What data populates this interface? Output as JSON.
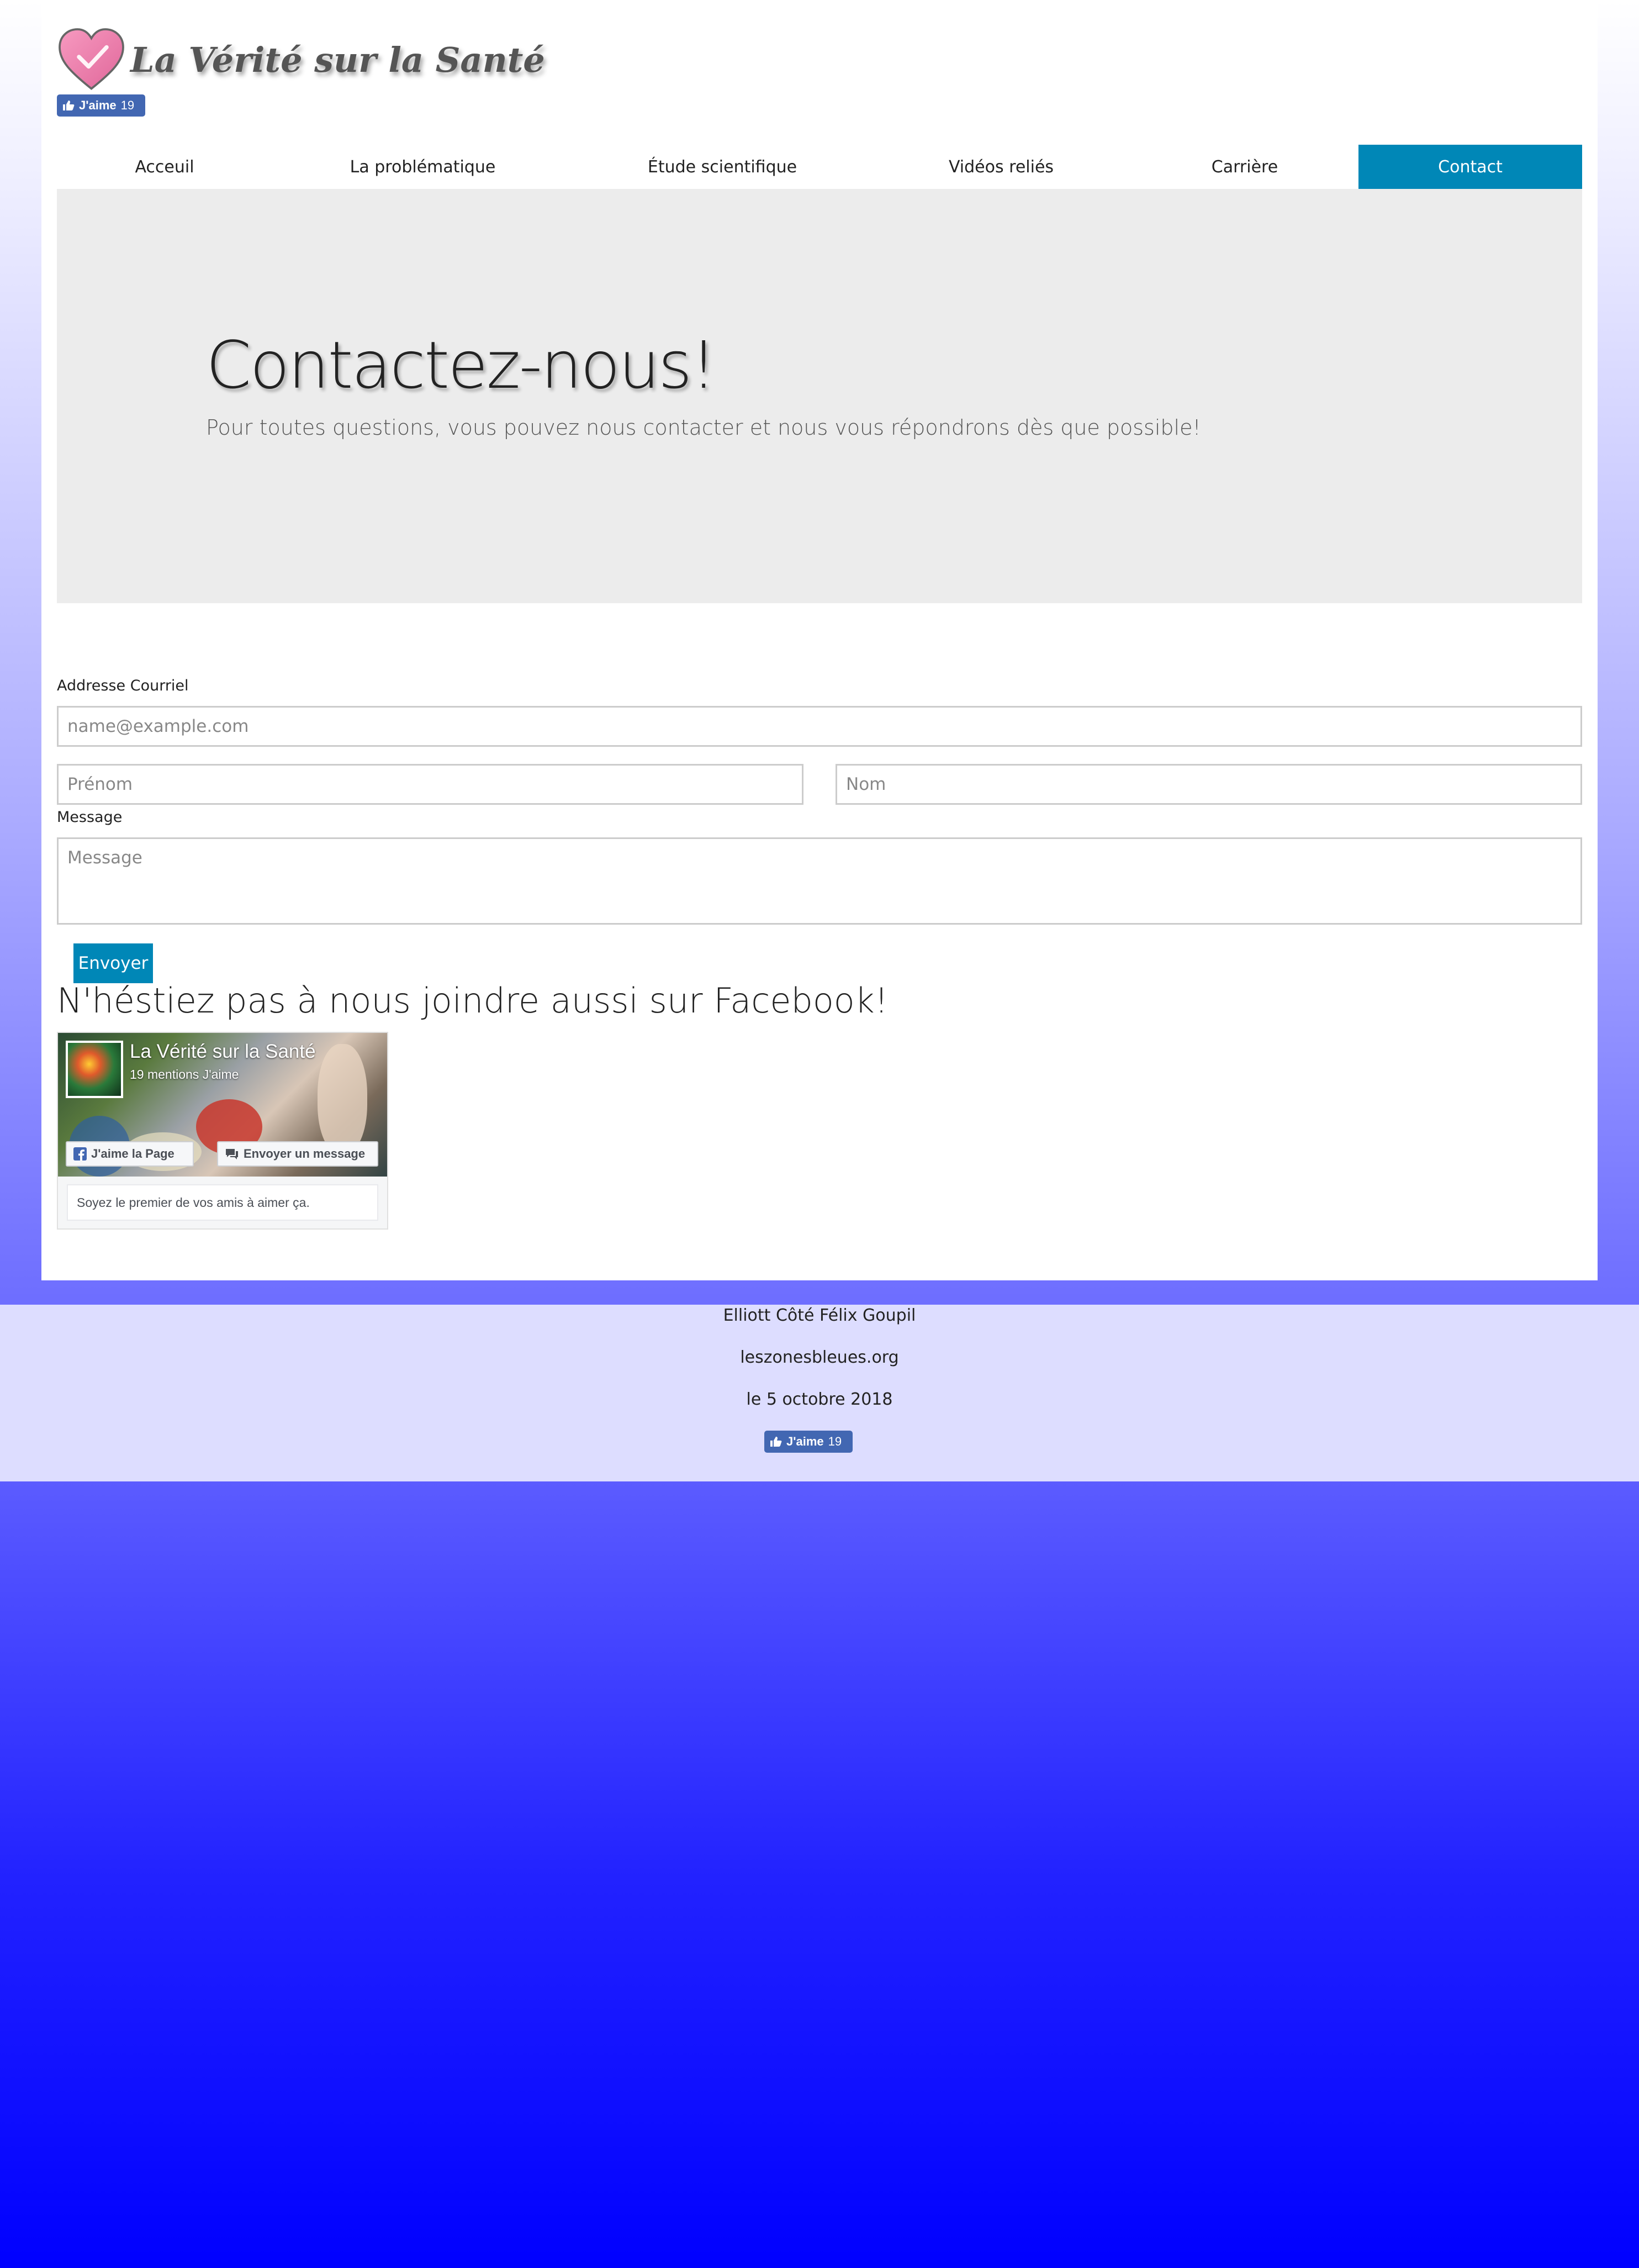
{
  "brand": {
    "name": "La Vérité sur la Santé"
  },
  "fb_like_button": {
    "label": "J'aime",
    "count": "19"
  },
  "nav": {
    "items": [
      {
        "label": "Acceuil"
      },
      {
        "label": "La problématique"
      },
      {
        "label": "Étude scientifique"
      },
      {
        "label": "Vidéos reliés"
      },
      {
        "label": "Carrière"
      },
      {
        "label": "Contact"
      }
    ],
    "active_index": 5
  },
  "hero": {
    "title": "Contactez-nous!",
    "subtitle": "Pour toutes questions, vous pouvez nous contacter et nous vous répondrons dès que possible!"
  },
  "form": {
    "email_label": "Addresse Courriel",
    "email_placeholder": "name@example.com",
    "firstname_placeholder": "Prénom",
    "lastname_placeholder": "Nom",
    "message_label": "Message",
    "message_placeholder": "Message",
    "submit_label": "Envoyer"
  },
  "facebook": {
    "heading": "N'héstiez pas à nous joindre aussi sur Facebook!",
    "page_name": "La Vérité sur la Santé",
    "likes_text": "19 mentions J'aime",
    "like_page_button": "J'aime la Page",
    "message_button": "Envoyer un message",
    "friends_text": "Soyez le premier de vos amis à aimer ça."
  },
  "footer": {
    "authors": "Elliott Côté Félix Goupil",
    "site": "leszonesbleues.org",
    "date": "le 5 octobre 2018"
  },
  "colors": {
    "accent": "#0087b7",
    "facebook_blue": "#4267b2",
    "hero_bg": "#ececec",
    "footer_bg": "#ddddff"
  }
}
